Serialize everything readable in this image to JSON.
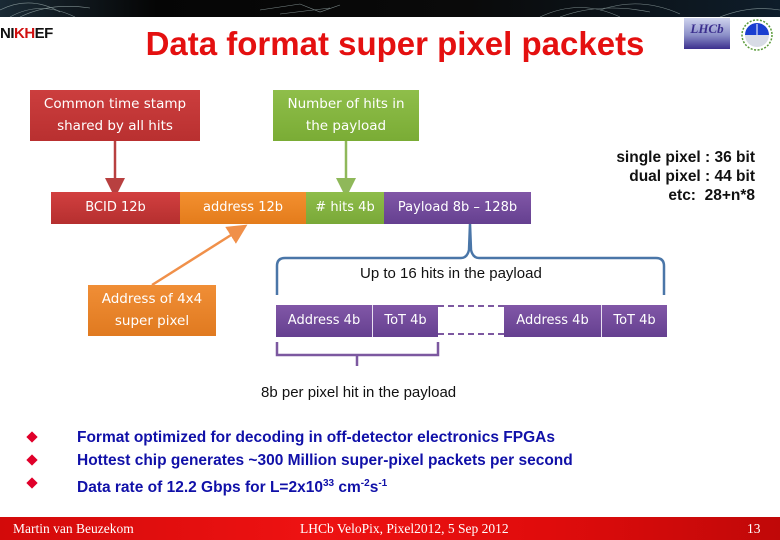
{
  "header": {
    "title": "Data format super pixel packets",
    "logos": {
      "left": {
        "name": "nikhef-logo",
        "text_prefix": "NI",
        "text_highlight": "KH",
        "text_suffix": "EF"
      },
      "right_1": {
        "name": "lhcb-logo",
        "text": "LHCb"
      },
      "right_2": {
        "name": "velo-logo"
      }
    }
  },
  "callouts": {
    "timestamp": {
      "line1": "Common time stamp",
      "line2": "shared by all hits"
    },
    "nhits": {
      "line1": "Number of hits in",
      "line2": "the payload"
    },
    "address": {
      "line1": "Address of 4x4",
      "line2": "super pixel"
    }
  },
  "packet": {
    "segments": [
      {
        "label": "BCID 12b",
        "color": "#c23535"
      },
      {
        "label": "address 12b",
        "color": "#ec8526"
      },
      {
        "label": "# hits 4b",
        "color": "#84b440"
      },
      {
        "label": "Payload 8b – 128b",
        "color": "#72499b"
      }
    ]
  },
  "sizes": {
    "lines": [
      "single pixel : 36 bit",
      "dual pixel : 44 bit",
      "etc:  28+n*8"
    ]
  },
  "payload": {
    "brace_label": "Up to 16 hits in the payload",
    "hits": [
      {
        "address": "Address 4b",
        "tot": "ToT 4b"
      },
      {
        "address": "Address 4b",
        "tot": "ToT 4b"
      }
    ],
    "hit_brace_label": "8b per pixel hit in the payload"
  },
  "bullets": [
    {
      "text": "Format optimized for decoding in off-detector electronics FPGAs"
    },
    {
      "text": "Hottest chip generates ~300 Million super-pixel packets per second"
    },
    {
      "text_main": "Data rate of 12.2 Gbps for L=2x10",
      "sup1": "33",
      "mid": " cm",
      "sup2": "-2",
      "mid2": "s",
      "sup3": "-1"
    }
  ],
  "footer": {
    "author": "Martin van Beuzekom",
    "event": "LHCb VeloPix, Pixel2012, 5 Sep 2012",
    "page": "13"
  },
  "colors": {
    "title": "#e41010",
    "bullet_text": "#1010a8",
    "bullet_marker": "#e0002a",
    "footer_bg": "#e00c0c",
    "brace": "#4a76a8",
    "hit_brace": "#7c58a0"
  }
}
